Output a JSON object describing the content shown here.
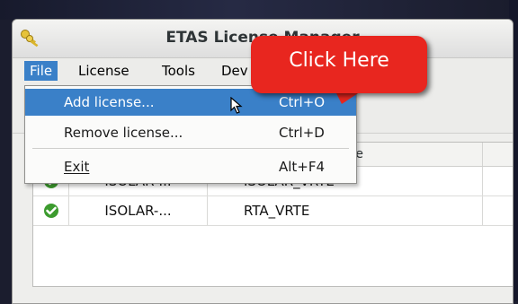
{
  "window": {
    "title": "ETAS License Manager"
  },
  "menubar": {
    "items": [
      {
        "label": "File"
      },
      {
        "label": "License"
      },
      {
        "label": "Tools"
      },
      {
        "label": "Dev"
      }
    ]
  },
  "file_menu": {
    "items": [
      {
        "label": "Add license...",
        "accelerator": "Ctrl+O",
        "highlighted": true
      },
      {
        "label": "Remove license...",
        "accelerator": "Ctrl+D"
      },
      {
        "label": "Exit",
        "accelerator": "Alt+F4"
      }
    ]
  },
  "table": {
    "headers": {
      "feature_partial": "ure"
    },
    "rows": [
      {
        "status_icon": "check-circle-icon",
        "product": "ISOLAR-...",
        "feature": "ISOLAR_VRTE",
        "extra": "I"
      },
      {
        "status_icon": "check-circle-icon",
        "product": "ISOLAR-...",
        "feature": "RTA_VRTE",
        "extra": "I"
      }
    ]
  },
  "callout": {
    "text": "Click Here",
    "color": "#e8261f"
  },
  "colors": {
    "menu_highlight": "#3a80c8",
    "status_green": "#3c9b2e"
  }
}
